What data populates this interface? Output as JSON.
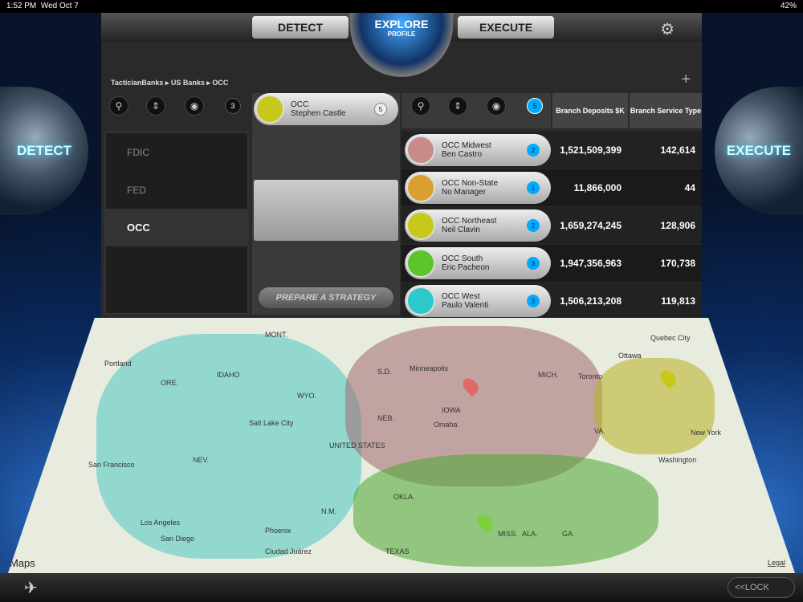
{
  "status": {
    "time": "1:52 PM",
    "date": "Wed Oct 7",
    "battery": "42%"
  },
  "top": {
    "detect": "DETECT",
    "explore": "EXPLORE",
    "profile": "PROFILE",
    "execute": "EXECUTE"
  },
  "orbs": {
    "left": "DETECT",
    "right": "EXECUTE"
  },
  "breadcrumb": "TacticianBanks ▸ US Banks ▸ OCC",
  "left_count": "3",
  "regulators": [
    "FDIC",
    "FED",
    "OCC"
  ],
  "parent": {
    "title": "OCC",
    "manager": "Stephen Castle",
    "count": "5",
    "color": "#c8c81a"
  },
  "prepare": "PREPARE A STRATEGY",
  "child_count": "5",
  "columns": [
    "Branch Deposits $K",
    "Branch Service Type"
  ],
  "rows": [
    {
      "title": "OCC Midwest",
      "manager": "Ben Castro",
      "count": "2",
      "color": "#c98a8a",
      "deposits": "1,521,509,399",
      "service": "142,614"
    },
    {
      "title": "OCC Non-State",
      "manager": "No Manager",
      "count": "1",
      "color": "#d9a030",
      "deposits": "11,866,000",
      "service": "44"
    },
    {
      "title": "OCC Northeast",
      "manager": "Neil Clavin",
      "count": "2",
      "color": "#c8c81a",
      "deposits": "1,659,274,245",
      "service": "128,906"
    },
    {
      "title": "OCC South",
      "manager": "Eric Pacheon",
      "count": "3",
      "color": "#5cc52a",
      "deposits": "1,947,356,963",
      "service": "170,738"
    },
    {
      "title": "OCC West",
      "manager": "Paulo Valenti",
      "count": "3",
      "color": "#2cc9c9",
      "deposits": "1,506,213,208",
      "service": "119,813"
    }
  ],
  "map": {
    "labels": [
      "MONT.",
      "IDAHO",
      "ORE.",
      "WYO.",
      "NEV.",
      "Portland",
      "Salt Lake City",
      "San Francisco",
      "Los Angeles",
      "San Diego",
      "Phoenix",
      "Ciudad Juárez",
      "N.M.",
      "UNITED STATES",
      "NEB.",
      "S.D.",
      "Minneapolis",
      "IOWA",
      "Omaha",
      "MICH.",
      "Toronto",
      "Ottawa",
      "Quebec City",
      "New York",
      "Washington",
      "OKLA.",
      "TEXAS",
      "MISS.",
      "ALA.",
      "GA.",
      "VA."
    ],
    "brand": "Maps",
    "legal": "Legal"
  },
  "lock": "<<LOCK"
}
